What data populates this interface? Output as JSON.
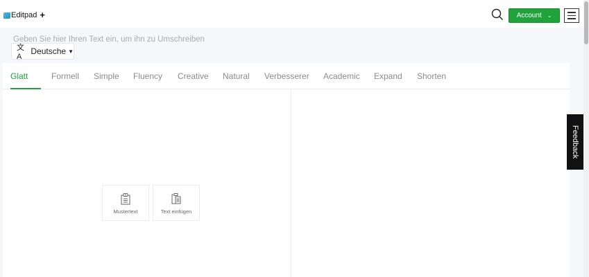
{
  "header": {
    "logo_text": "Editpad",
    "new_label": "+",
    "account_label": "Account",
    "search_icon": "search-icon",
    "menu_icon": "hamburger-menu-icon",
    "accent_color": "#1fa33a"
  },
  "language": {
    "icon": "translate-icon",
    "selected": "Deutsche"
  },
  "tabs": [
    {
      "label": "Glatt",
      "active": true
    },
    {
      "label": "Formell"
    },
    {
      "label": "Simple"
    },
    {
      "label": "Fluency"
    },
    {
      "label": "Creative"
    },
    {
      "label": "Natural"
    },
    {
      "label": "Verbesserer"
    },
    {
      "label": "Academic"
    },
    {
      "label": "Expand"
    },
    {
      "label": "Shorten"
    }
  ],
  "editor": {
    "placeholder": "Geben Sie hier Ihren Text ein, um ihn zu Umschreiben",
    "sample_label": "Mustertext",
    "paste_label": "Text einfügen"
  },
  "feedback_label": "Feedback"
}
